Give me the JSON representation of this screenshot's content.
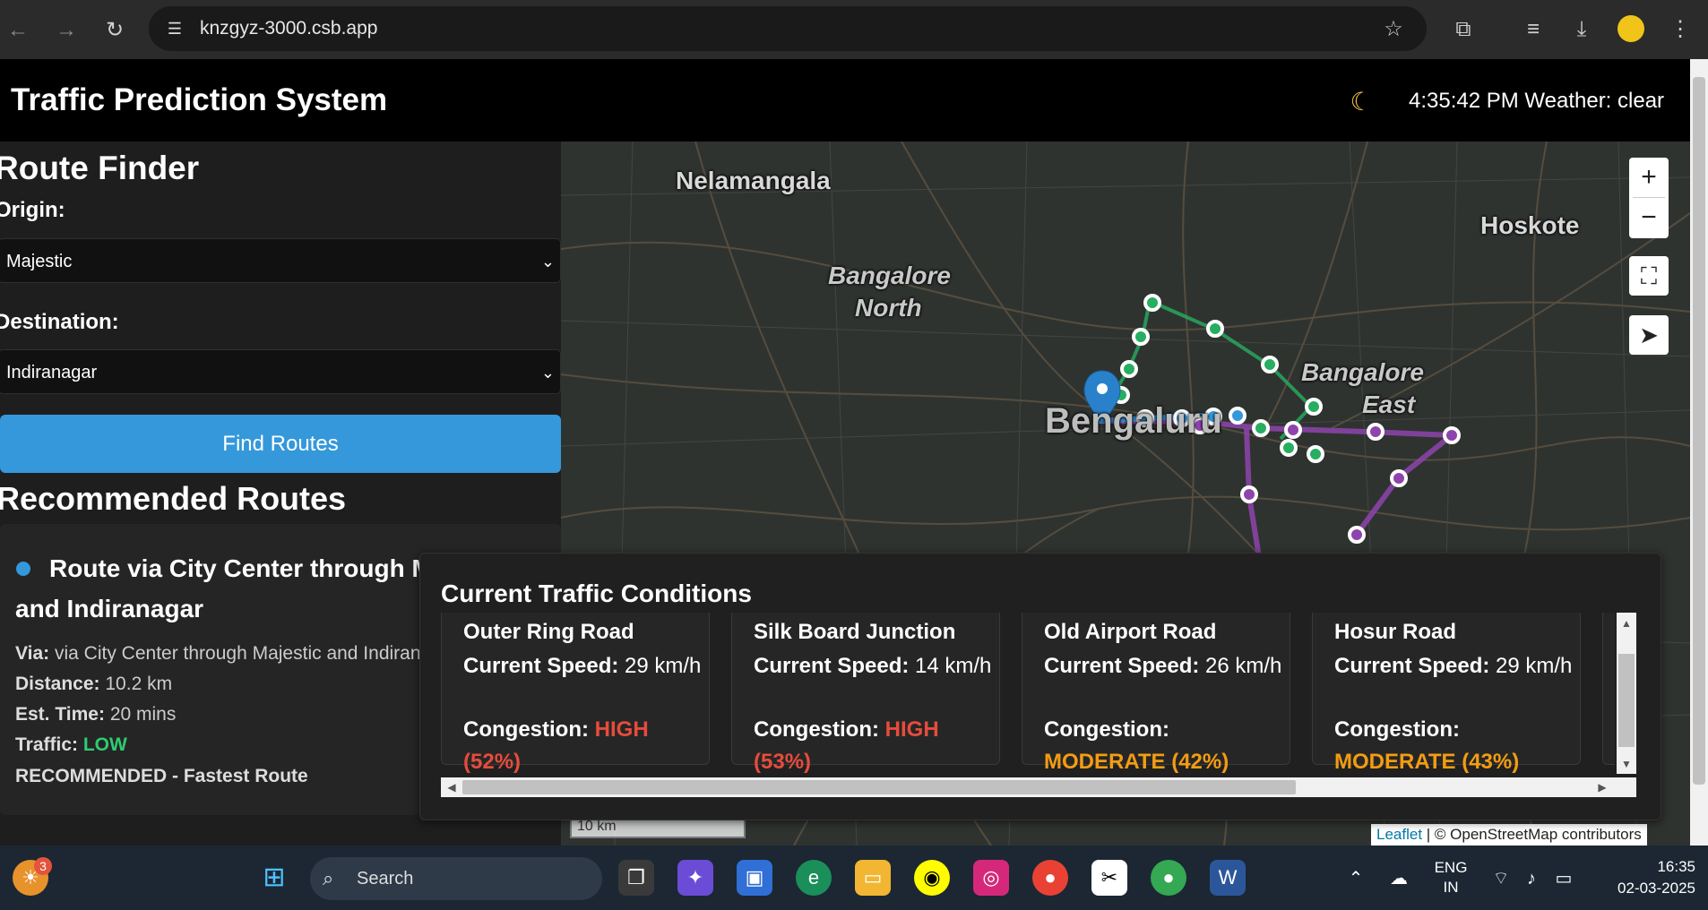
{
  "browser": {
    "url": "knzgyz-3000.csb.app"
  },
  "header": {
    "title": "Traffic Prediction System",
    "time_weather": "4:35:42 PM Weather: clear"
  },
  "sidebar": {
    "route_finder_title": "Route Finder",
    "origin_label": "Origin:",
    "origin_value": "Majestic",
    "destination_label": "Destination:",
    "destination_value": "Indiranagar",
    "find_button": "Find Routes",
    "recommended_title": "Recommended Routes",
    "route": {
      "title_line1": "Route via City Center through Majestic",
      "title_line2": "and Indiranagar",
      "via_label": "Via:",
      "via_value": "via City Center through Majestic and Indiranagar",
      "distance_label": "Distance:",
      "distance_value": "10.2 km",
      "time_label": "Est. Time:",
      "time_value": "20 mins",
      "traffic_label": "Traffic:",
      "traffic_value": "LOW",
      "note": "RECOMMENDED - Fastest Route"
    }
  },
  "map": {
    "labels": [
      "Nelamangala",
      "Hoskote",
      "Bangalore",
      "North",
      "Bangalore",
      "East",
      "Bengaluru"
    ],
    "zoom_in": "+",
    "zoom_out": "−",
    "scale": "10 km",
    "attribution_link": "Leaflet",
    "attribution_text": "| © OpenStreetMap contributors",
    "colors": {
      "route_green": "#27ae60",
      "route_purple": "#8e44ad",
      "route_blue": "#3498db"
    }
  },
  "traffic": {
    "title": "Current Traffic Conditions",
    "speed_label": "Current Speed:",
    "congestion_label": "Congestion:",
    "cards": [
      {
        "name": "Outer Ring Road",
        "speed": "29 km/h",
        "congestion": "HIGH (52%)",
        "level": "high"
      },
      {
        "name": "Silk Board Junction",
        "speed": "14 km/h",
        "congestion": "HIGH (53%)",
        "level": "high"
      },
      {
        "name": "Old Airport Road",
        "speed": "26 km/h",
        "congestion": "MODERATE (42%)",
        "level": "moderate"
      },
      {
        "name": "Hosur Road",
        "speed": "29 km/h",
        "congestion": "MODERATE (43%)",
        "level": "moderate"
      }
    ]
  },
  "taskbar": {
    "search_placeholder": "Search",
    "weather_badge": "3",
    "lang_line1": "ENG",
    "lang_line2": "IN",
    "time": "16:35",
    "date": "02-03-2025"
  }
}
